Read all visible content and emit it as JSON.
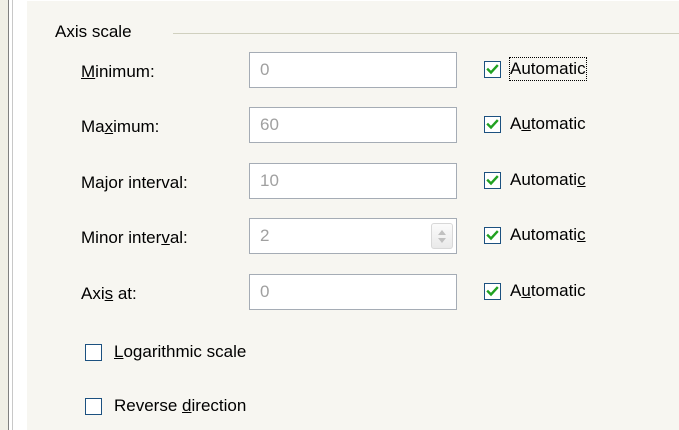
{
  "group": {
    "title": "Axis scale"
  },
  "rows": [
    {
      "label_pre": "",
      "label_key": "M",
      "label_post": "inimum:",
      "value": "0",
      "auto_pre": "Automatic",
      "auto_key": "",
      "auto_post": "",
      "auto_checked": true
    },
    {
      "label_pre": "Ma",
      "label_key": "x",
      "label_post": "imum:",
      "value": "60",
      "auto_pre": "A",
      "auto_key": "u",
      "auto_post": "tomatic",
      "auto_checked": true
    },
    {
      "label_pre": "Major interval:",
      "label_key": "",
      "label_post": "",
      "value": "10",
      "auto_pre": "Automati",
      "auto_key": "c",
      "auto_post": "",
      "auto_checked": true
    },
    {
      "label_pre": "Minor inter",
      "label_key": "v",
      "label_post": "al:",
      "value": "2",
      "auto_pre": "Automati",
      "auto_key": "c",
      "auto_post": "",
      "auto_checked": true
    },
    {
      "label_pre": "Axi",
      "label_key": "s",
      "label_post": " at:",
      "value": "0",
      "auto_pre": "A",
      "auto_key": "u",
      "auto_post": "tomatic",
      "auto_checked": true
    }
  ],
  "options": {
    "logarithmic": {
      "pre": "",
      "key": "L",
      "post": "ogarithmic scale",
      "checked": false
    },
    "reverse": {
      "pre": "Reverse ",
      "key": "d",
      "post": "irection",
      "checked": false
    }
  },
  "colors": {
    "check": "#21a121",
    "checkbox_border": "#1c5180",
    "disabled_text": "#a0a0a0"
  }
}
